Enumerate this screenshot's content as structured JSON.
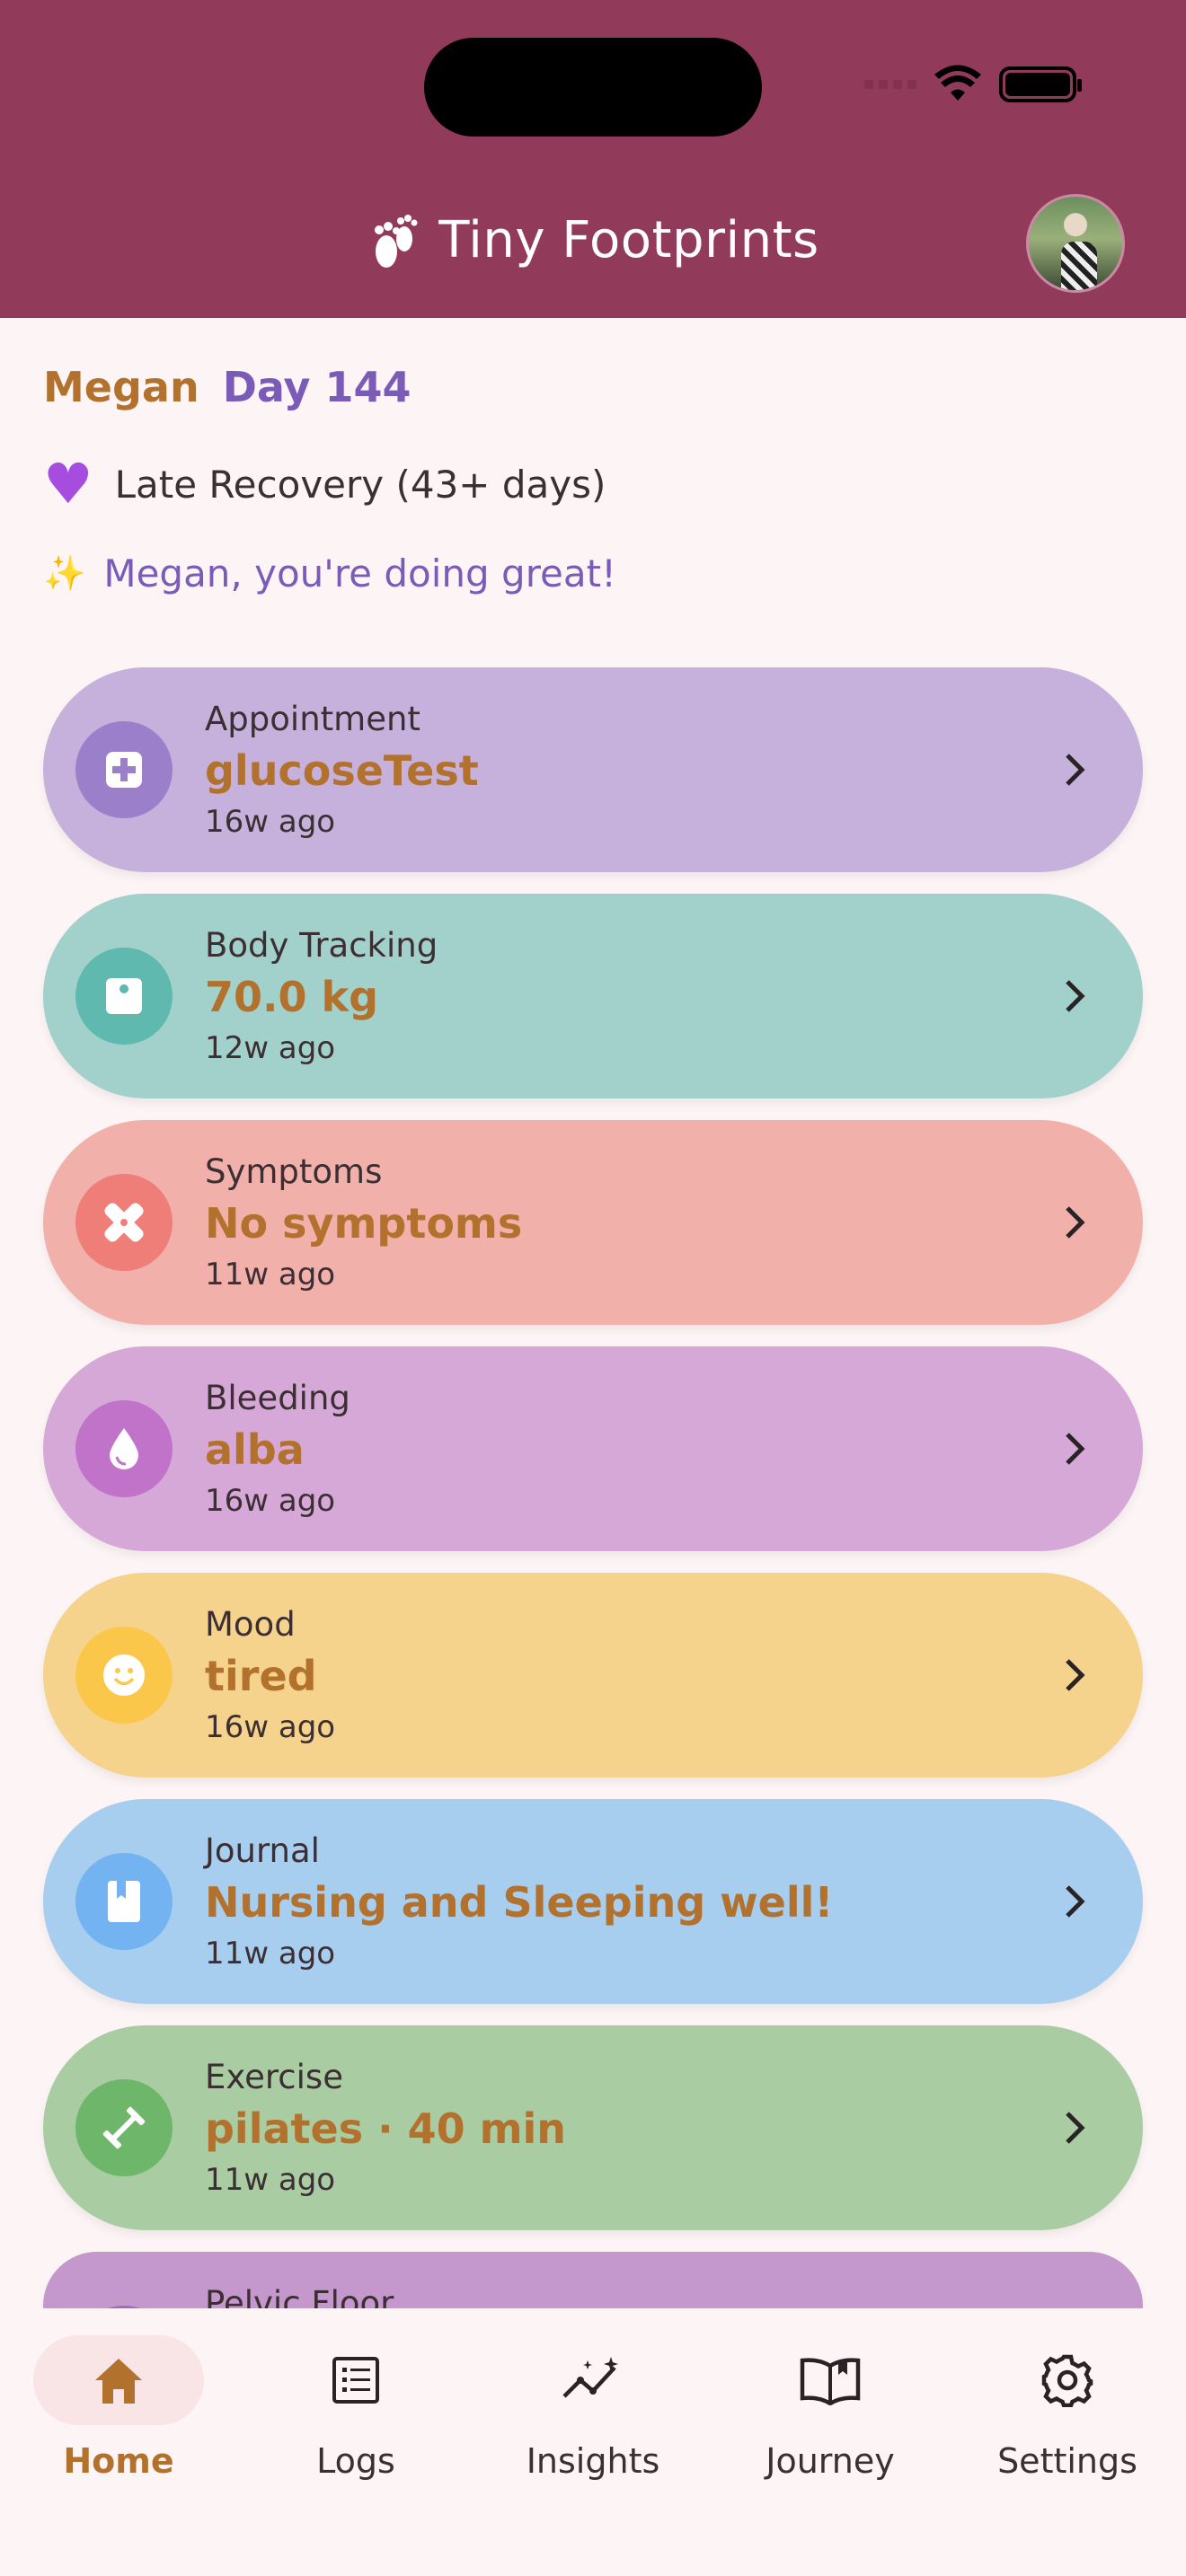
{
  "app": {
    "title": "Tiny Footprints",
    "colors": {
      "header": "#923a5a",
      "accent": "#b2712c",
      "purple": "#7a5cb8"
    }
  },
  "greeting": {
    "name": "Megan",
    "day": "Day 144",
    "phase": "Late Recovery (43+ days)",
    "encouragement": "Megan, you're doing great!"
  },
  "cards": [
    {
      "category": "Appointment",
      "value": "glucoseTest",
      "ago": "16w ago",
      "icon": "medical-cross-icon",
      "bg": "#c5b1dc",
      "iconbg": "#9b7fcb"
    },
    {
      "category": "Body Tracking",
      "value": "70.0 kg",
      "ago": "12w ago",
      "icon": "scale-icon",
      "bg": "#a1d1ca",
      "iconbg": "#60b9ae"
    },
    {
      "category": "Symptoms",
      "value": "No symptoms",
      "ago": "11w ago",
      "icon": "bandage-icon",
      "bg": "#f2b0aa",
      "iconbg": "#ef7d78"
    },
    {
      "category": "Bleeding",
      "value": "alba",
      "ago": "16w ago",
      "icon": "drop-icon",
      "bg": "#d6a8d8",
      "iconbg": "#c173c9"
    },
    {
      "category": "Mood",
      "value": "tired",
      "ago": "16w ago",
      "icon": "smiley-icon",
      "bg": "#f6d38c",
      "iconbg": "#fbc74b"
    },
    {
      "category": "Journal",
      "value": "Nursing and Sleeping well!",
      "ago": "11w ago",
      "icon": "book-icon",
      "bg": "#a7cdef",
      "iconbg": "#73b3f1"
    },
    {
      "category": "Exercise",
      "value": "pilates · 40 min",
      "ago": "11w ago",
      "icon": "dumbbell-icon",
      "bg": "#a9cca2",
      "iconbg": "#6eb66a"
    },
    {
      "category": "Pelvic Floor",
      "value": "",
      "ago": "",
      "icon": "",
      "bg": "#c497cd",
      "iconbg": "#a56ab5"
    }
  ],
  "nav": [
    {
      "label": "Home",
      "icon": "home-icon",
      "active": true
    },
    {
      "label": "Logs",
      "icon": "list-icon",
      "active": false
    },
    {
      "label": "Insights",
      "icon": "insights-icon",
      "active": false
    },
    {
      "label": "Journey",
      "icon": "open-book-icon",
      "active": false
    },
    {
      "label": "Settings",
      "icon": "gear-icon",
      "active": false
    }
  ]
}
